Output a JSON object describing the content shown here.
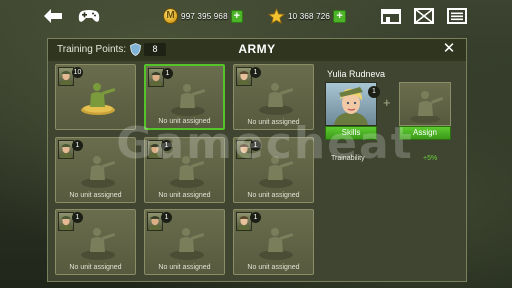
{
  "topbar": {
    "gold_amount": "997 395 968",
    "gold_icon_letter": "M",
    "star_amount": "10 368 726",
    "icons": [
      "back-arrow-icon",
      "gamepad-icon",
      "coin-icon",
      "star-icon",
      "shop-icon",
      "mail-icon",
      "menu-icon"
    ]
  },
  "panel": {
    "training_points_label": "Training Points:",
    "training_points_value": "8",
    "title": "ARMY",
    "close_label": "✕"
  },
  "slots": [
    {
      "badge": "10",
      "caption": "",
      "selected": false,
      "assigned": true
    },
    {
      "badge": "1",
      "caption": "No unit assigned",
      "selected": true,
      "assigned": false
    },
    {
      "badge": "1",
      "caption": "No unit assigned",
      "selected": false,
      "assigned": false
    },
    {
      "badge": "1",
      "caption": "No unit assigned",
      "selected": false,
      "assigned": false
    },
    {
      "badge": "1",
      "caption": "No unit assigned",
      "selected": false,
      "assigned": false
    },
    {
      "badge": "1",
      "caption": "No unit assigned",
      "selected": false,
      "assigned": false
    },
    {
      "badge": "1",
      "caption": "No unit assigned",
      "selected": false,
      "assigned": false
    },
    {
      "badge": "1",
      "caption": "No unit assigned",
      "selected": false,
      "assigned": false
    },
    {
      "badge": "1",
      "caption": "No unit assigned",
      "selected": false,
      "assigned": false
    }
  ],
  "commander": {
    "name": "Yulia Rudneva",
    "badge": "1",
    "skills_label": "Skills",
    "assign_label": "Assign",
    "trainability_label": "Trainability",
    "trainability_value": "+5%"
  },
  "watermark": "Gamecheat",
  "colors": {
    "accent_green": "#56c32a",
    "button_green": "#4db328",
    "panel_bg": "#3f4530",
    "slot_bg": "#6a6d4d"
  }
}
